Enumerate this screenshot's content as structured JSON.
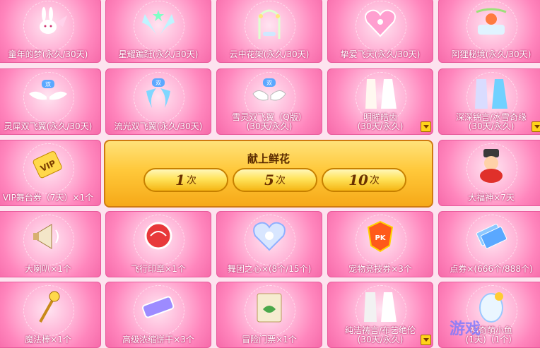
{
  "items": [
    {
      "label": "童年的梦(永久/30天)",
      "icon": "rabbit-wings-icon",
      "arrow": false
    },
    {
      "label": "星耀蹁跹(永久/30天)",
      "icon": "star-wings-icon",
      "arrow": false
    },
    {
      "label": "云中花架(永久/30天)",
      "icon": "flower-swing-icon",
      "arrow": false
    },
    {
      "label": "挚爱飞天(永久/30天)",
      "icon": "heart-ornament-icon",
      "arrow": false
    },
    {
      "label": "阿狸秘境(永久/30天)",
      "icon": "ali-garden-icon",
      "arrow": false
    },
    {
      "label": "灵犀双飞翼(永久/30天)",
      "icon": "double-wings-icon",
      "arrow": false
    },
    {
      "label": "流光双飞翼(永久/30天)",
      "icon": "blue-wings-icon",
      "arrow": false
    },
    {
      "label": "雪灵双飞翼（Q版）\n(30天/永久)",
      "icon": "snow-wings-icon",
      "arrow": false
    },
    {
      "label": "明眸皓齿\n(30天/永久)",
      "icon": "white-outfits-icon",
      "arrow": true
    },
    {
      "label": "深深锦言/冰雪奇缘\n(30天/永久)",
      "icon": "ice-outfits-icon",
      "arrow": true
    },
    {
      "label": "VIP舞台券（7天）×1个",
      "icon": "vip-ticket-icon",
      "arrow": false
    },
    {
      "label": "大福神×7天",
      "icon": "fortune-god-icon",
      "arrow": false
    },
    {
      "label": "大喇叭×1个",
      "icon": "megaphone-icon",
      "arrow": false
    },
    {
      "label": "飞行印章×1个",
      "icon": "flight-stamp-icon",
      "arrow": false
    },
    {
      "label": "舞团之心×(8个/15个)",
      "icon": "crystal-heart-icon",
      "arrow": false
    },
    {
      "label": "宠物竞技券×3个",
      "icon": "pet-pk-ticket-icon",
      "arrow": false
    },
    {
      "label": "点券×(666个/888个)",
      "icon": "coupon-cards-icon",
      "arrow": false
    },
    {
      "label": "魔法棒×1个",
      "icon": "magic-wand-icon",
      "arrow": false
    },
    {
      "label": "高级浓缩饼干×3个",
      "icon": "biscuit-pack-icon",
      "arrow": false
    },
    {
      "label": "冒险门票×1个",
      "icon": "adventure-scroll-icon",
      "arrow": false
    },
    {
      "label": "纯洁祷言/布艺绝伦\n(30天/永久)",
      "icon": "wedding-outfits-icon",
      "arrow": true
    },
    {
      "label": "神奇萌小鱼\n(1天)（1个）",
      "icon": "fish-egg-icon",
      "arrow": false
    }
  ],
  "panel": {
    "title": "献上鲜花",
    "buttons": [
      {
        "count": "1",
        "unit": "次"
      },
      {
        "count": "5",
        "unit": "次"
      },
      {
        "count": "10",
        "unit": "次"
      }
    ]
  },
  "colors": {
    "cell_pink": "#ff86bd",
    "cell_border": "#e85a9c",
    "panel_gold": "#ffc83a",
    "label_shadow": "#b8306e"
  },
  "watermark": "游戏"
}
